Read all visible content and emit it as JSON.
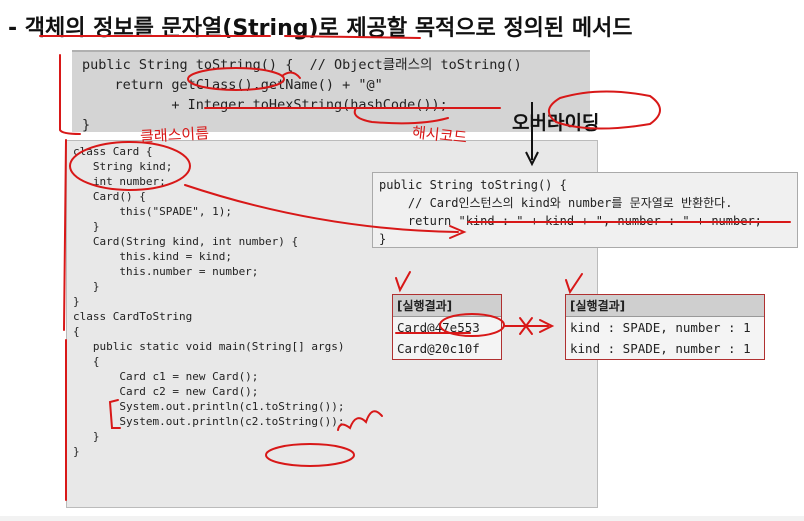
{
  "heading": "- 객체의 정보를 문자열(String)로 제공할 목적으로 정의된 메서드",
  "top_code": [
    "public String toString() {  // Object클래스의 toString()",
    "    return getClass().getName() + \"@\"",
    "           + Integer.toHexString(hashCode());",
    "}"
  ],
  "class_code": [
    "class Card {",
    "   String kind;",
    "   int number;",
    "",
    "   Card() {",
    "       this(\"SPADE\", 1);",
    "   }",
    "   Card(String kind, int number) {",
    "       this.kind = kind;",
    "       this.number = number;",
    "   }",
    "}",
    "",
    "class CardToString",
    "{",
    "   public static void main(String[] args)",
    "   {",
    "       Card c1 = new Card();",
    "       Card c2 = new Card();",
    "",
    "       System.out.println(c1.toString());",
    "       System.out.println(c2.toString());",
    "   }",
    "}"
  ],
  "override_code": [
    "public String toString() {",
    "    // Card인스턴스의 kind와 number를 문자열로 반환한다.",
    "    return \"kind : \" + kind + \", number : \" + number;",
    "}"
  ],
  "result1": {
    "header": "[실행결과]",
    "lines": [
      "Card@47e553",
      "Card@20c10f"
    ]
  },
  "result2": {
    "header": "[실행결과]",
    "lines": [
      "kind : SPADE, number : 1",
      "kind : SPADE, number : 1"
    ]
  },
  "annotations": {
    "class_name": "클래스이름",
    "hash_code": "해시코드",
    "override": "오버라이딩"
  },
  "colors": {
    "ink": "#d81818",
    "code_bg": "#e8e8e8",
    "top_bg": "#d4d4d4"
  }
}
